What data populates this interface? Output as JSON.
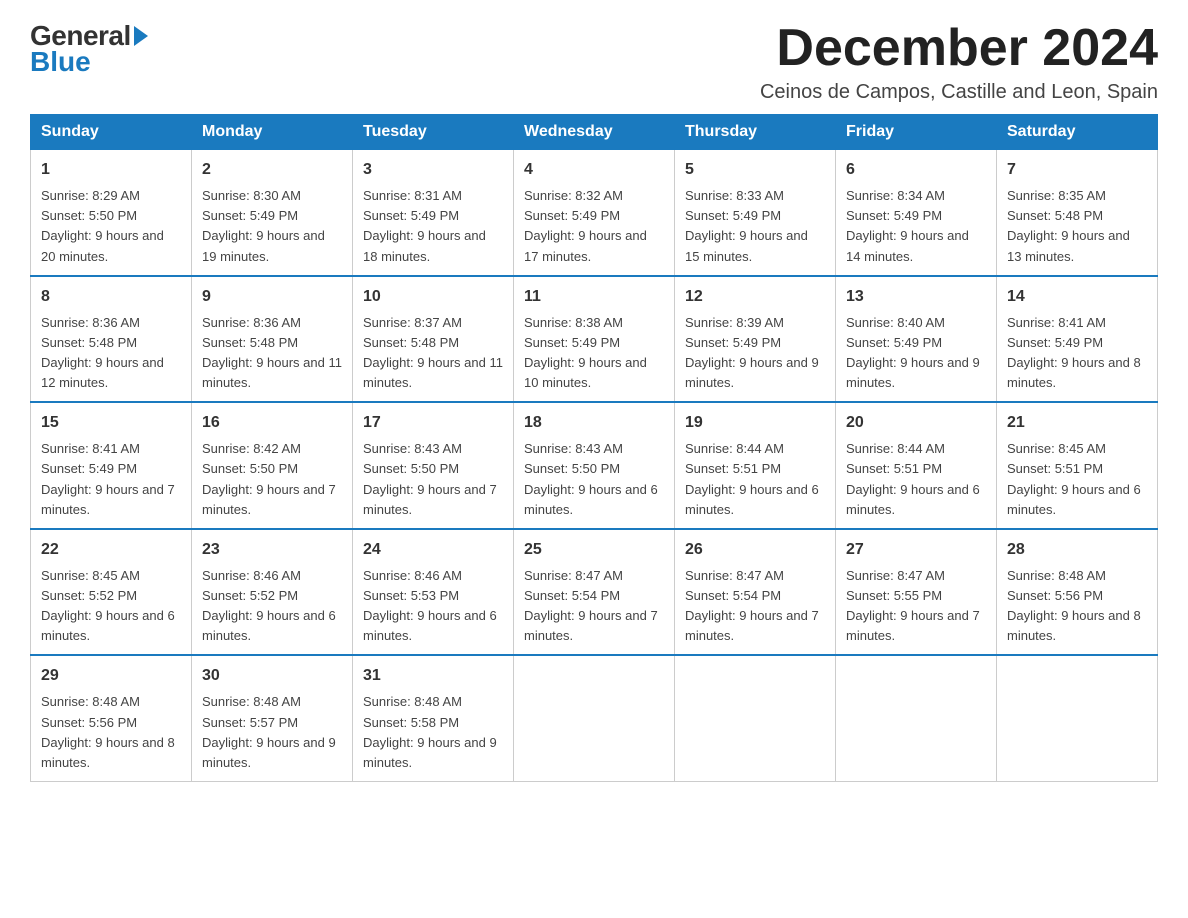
{
  "logo": {
    "general_text": "General",
    "blue_text": "Blue"
  },
  "title": "December 2024",
  "subtitle": "Ceinos de Campos, Castille and Leon, Spain",
  "days_of_week": [
    "Sunday",
    "Monday",
    "Tuesday",
    "Wednesday",
    "Thursday",
    "Friday",
    "Saturday"
  ],
  "weeks": [
    [
      {
        "day": "1",
        "sunrise": "8:29 AM",
        "sunset": "5:50 PM",
        "daylight": "9 hours and 20 minutes."
      },
      {
        "day": "2",
        "sunrise": "8:30 AM",
        "sunset": "5:49 PM",
        "daylight": "9 hours and 19 minutes."
      },
      {
        "day": "3",
        "sunrise": "8:31 AM",
        "sunset": "5:49 PM",
        "daylight": "9 hours and 18 minutes."
      },
      {
        "day": "4",
        "sunrise": "8:32 AM",
        "sunset": "5:49 PM",
        "daylight": "9 hours and 17 minutes."
      },
      {
        "day": "5",
        "sunrise": "8:33 AM",
        "sunset": "5:49 PM",
        "daylight": "9 hours and 15 minutes."
      },
      {
        "day": "6",
        "sunrise": "8:34 AM",
        "sunset": "5:49 PM",
        "daylight": "9 hours and 14 minutes."
      },
      {
        "day": "7",
        "sunrise": "8:35 AM",
        "sunset": "5:48 PM",
        "daylight": "9 hours and 13 minutes."
      }
    ],
    [
      {
        "day": "8",
        "sunrise": "8:36 AM",
        "sunset": "5:48 PM",
        "daylight": "9 hours and 12 minutes."
      },
      {
        "day": "9",
        "sunrise": "8:36 AM",
        "sunset": "5:48 PM",
        "daylight": "9 hours and 11 minutes."
      },
      {
        "day": "10",
        "sunrise": "8:37 AM",
        "sunset": "5:48 PM",
        "daylight": "9 hours and 11 minutes."
      },
      {
        "day": "11",
        "sunrise": "8:38 AM",
        "sunset": "5:49 PM",
        "daylight": "9 hours and 10 minutes."
      },
      {
        "day": "12",
        "sunrise": "8:39 AM",
        "sunset": "5:49 PM",
        "daylight": "9 hours and 9 minutes."
      },
      {
        "day": "13",
        "sunrise": "8:40 AM",
        "sunset": "5:49 PM",
        "daylight": "9 hours and 9 minutes."
      },
      {
        "day": "14",
        "sunrise": "8:41 AM",
        "sunset": "5:49 PM",
        "daylight": "9 hours and 8 minutes."
      }
    ],
    [
      {
        "day": "15",
        "sunrise": "8:41 AM",
        "sunset": "5:49 PM",
        "daylight": "9 hours and 7 minutes."
      },
      {
        "day": "16",
        "sunrise": "8:42 AM",
        "sunset": "5:50 PM",
        "daylight": "9 hours and 7 minutes."
      },
      {
        "day": "17",
        "sunrise": "8:43 AM",
        "sunset": "5:50 PM",
        "daylight": "9 hours and 7 minutes."
      },
      {
        "day": "18",
        "sunrise": "8:43 AM",
        "sunset": "5:50 PM",
        "daylight": "9 hours and 6 minutes."
      },
      {
        "day": "19",
        "sunrise": "8:44 AM",
        "sunset": "5:51 PM",
        "daylight": "9 hours and 6 minutes."
      },
      {
        "day": "20",
        "sunrise": "8:44 AM",
        "sunset": "5:51 PM",
        "daylight": "9 hours and 6 minutes."
      },
      {
        "day": "21",
        "sunrise": "8:45 AM",
        "sunset": "5:51 PM",
        "daylight": "9 hours and 6 minutes."
      }
    ],
    [
      {
        "day": "22",
        "sunrise": "8:45 AM",
        "sunset": "5:52 PM",
        "daylight": "9 hours and 6 minutes."
      },
      {
        "day": "23",
        "sunrise": "8:46 AM",
        "sunset": "5:52 PM",
        "daylight": "9 hours and 6 minutes."
      },
      {
        "day": "24",
        "sunrise": "8:46 AM",
        "sunset": "5:53 PM",
        "daylight": "9 hours and 6 minutes."
      },
      {
        "day": "25",
        "sunrise": "8:47 AM",
        "sunset": "5:54 PM",
        "daylight": "9 hours and 7 minutes."
      },
      {
        "day": "26",
        "sunrise": "8:47 AM",
        "sunset": "5:54 PM",
        "daylight": "9 hours and 7 minutes."
      },
      {
        "day": "27",
        "sunrise": "8:47 AM",
        "sunset": "5:55 PM",
        "daylight": "9 hours and 7 minutes."
      },
      {
        "day": "28",
        "sunrise": "8:48 AM",
        "sunset": "5:56 PM",
        "daylight": "9 hours and 8 minutes."
      }
    ],
    [
      {
        "day": "29",
        "sunrise": "8:48 AM",
        "sunset": "5:56 PM",
        "daylight": "9 hours and 8 minutes."
      },
      {
        "day": "30",
        "sunrise": "8:48 AM",
        "sunset": "5:57 PM",
        "daylight": "9 hours and 9 minutes."
      },
      {
        "day": "31",
        "sunrise": "8:48 AM",
        "sunset": "5:58 PM",
        "daylight": "9 hours and 9 minutes."
      },
      null,
      null,
      null,
      null
    ]
  ]
}
